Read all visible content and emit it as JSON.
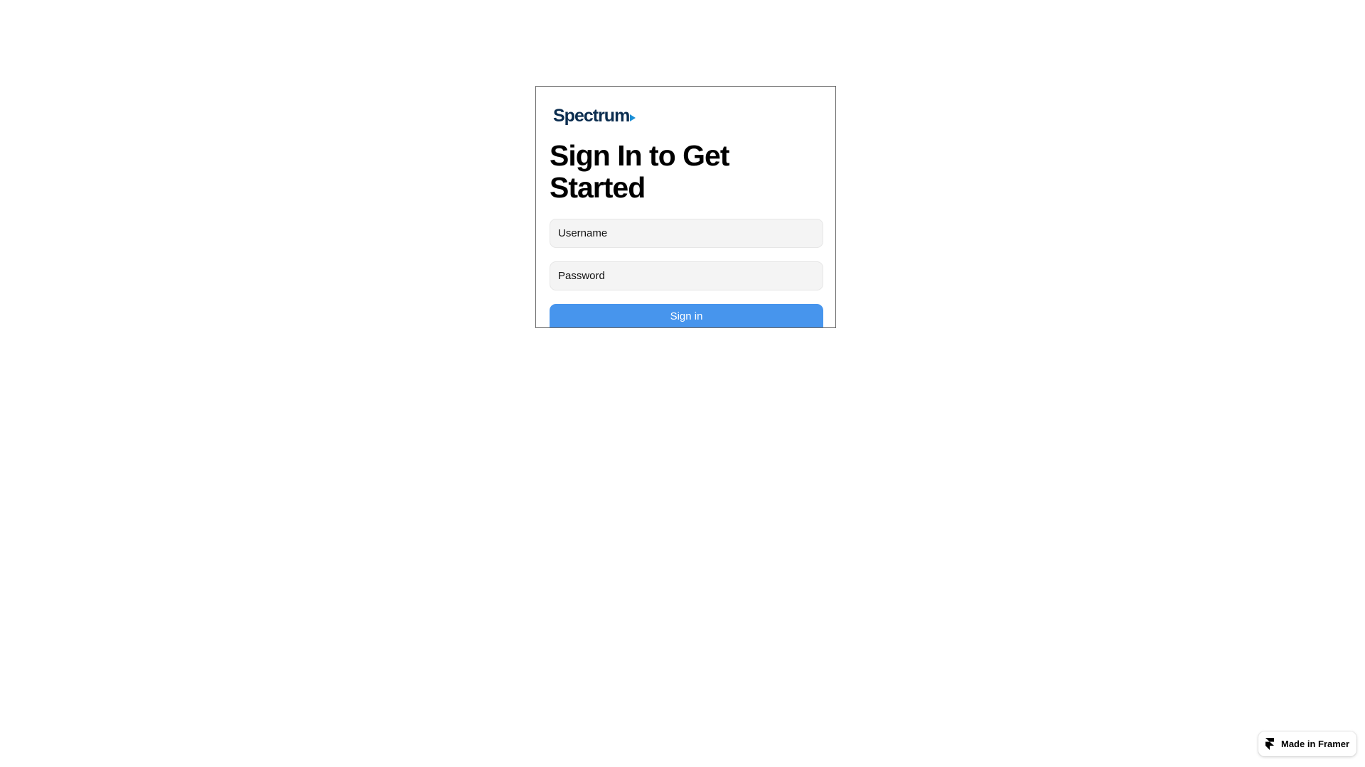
{
  "brand": {
    "logo_text": "Spectrum",
    "logo_color": "#0b2d4f",
    "arrow_color": "#1b8fd6"
  },
  "signin_card": {
    "title": "Sign In to Get Started",
    "username": {
      "placeholder": "Username",
      "value": ""
    },
    "password": {
      "placeholder": "Password",
      "value": ""
    },
    "submit_label": "Sign in",
    "submit_color": "#4795ed"
  },
  "framer_badge": {
    "label": "Made in Framer",
    "icon": "framer-logo-icon"
  }
}
